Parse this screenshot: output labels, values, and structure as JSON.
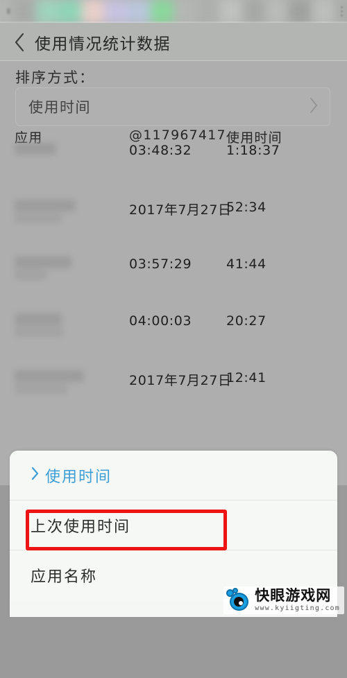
{
  "statusbar": {
    "blurred": true,
    "band_colors": [
      "#b4b6b4",
      "#a8aaa8",
      "#9fd3bd",
      "#8fd3b6",
      "#e8cfc9",
      "#c6c2e0",
      "#b9c6da",
      "#89d79a",
      "#b4b6b4",
      "#adafad",
      "#c0c2c0",
      "#a6a8a6",
      "#b9bbb9",
      "#9fa19f",
      "#bdbfbd",
      "#a9aba9"
    ]
  },
  "header": {
    "back_icon": "chevron-left-icon",
    "title": "使用情况统计数据"
  },
  "sort": {
    "label": "排序方式：",
    "value": "使用时间",
    "chevron_icon": "chevron-right-icon"
  },
  "table": {
    "columns": [
      "应用",
      "@117967417",
      "使用时间"
    ],
    "rows": [
      {
        "app": "",
        "mid": "03:48:32",
        "time": "1:18:37",
        "blur_widths": [
          60,
          0
        ]
      },
      {
        "app": "",
        "mid": "2017年7月27日",
        "time": "52:34",
        "blur_widths": [
          88,
          68
        ]
      },
      {
        "app": "",
        "mid": "03:57:29",
        "time": "41:44",
        "blur_widths": [
          82,
          46
        ]
      },
      {
        "app": "",
        "mid": "04:00:03",
        "time": "20:27",
        "blur_widths": [
          68,
          70
        ]
      },
      {
        "app": "",
        "mid": "2017年7月27日",
        "time": "12:41",
        "blur_widths": [
          100,
          76
        ]
      }
    ]
  },
  "sheet": {
    "items": [
      {
        "label": "使用时间",
        "selected": true,
        "chevron_icon": "chevron-right-icon"
      },
      {
        "label": "上次使用时间",
        "selected": false,
        "highlighted": true
      },
      {
        "label": "应用名称",
        "selected": false
      }
    ]
  },
  "annotation": {
    "type": "red-rectangle",
    "color": "#ef1414",
    "target_label": "上次使用时间"
  },
  "watermark": {
    "title": "快眼游戏网",
    "url": "www.kyiigting.com",
    "logo_icon": "eye-logo-icon",
    "accent_color": "#1a9fe0"
  },
  "colors": {
    "page_background": "#aeaeae",
    "appbar_background": "#b3b5b3",
    "sheet_background": "#f6f8f6",
    "accent_blue": "#3d9ed6",
    "annotation_red": "#ef1414"
  }
}
